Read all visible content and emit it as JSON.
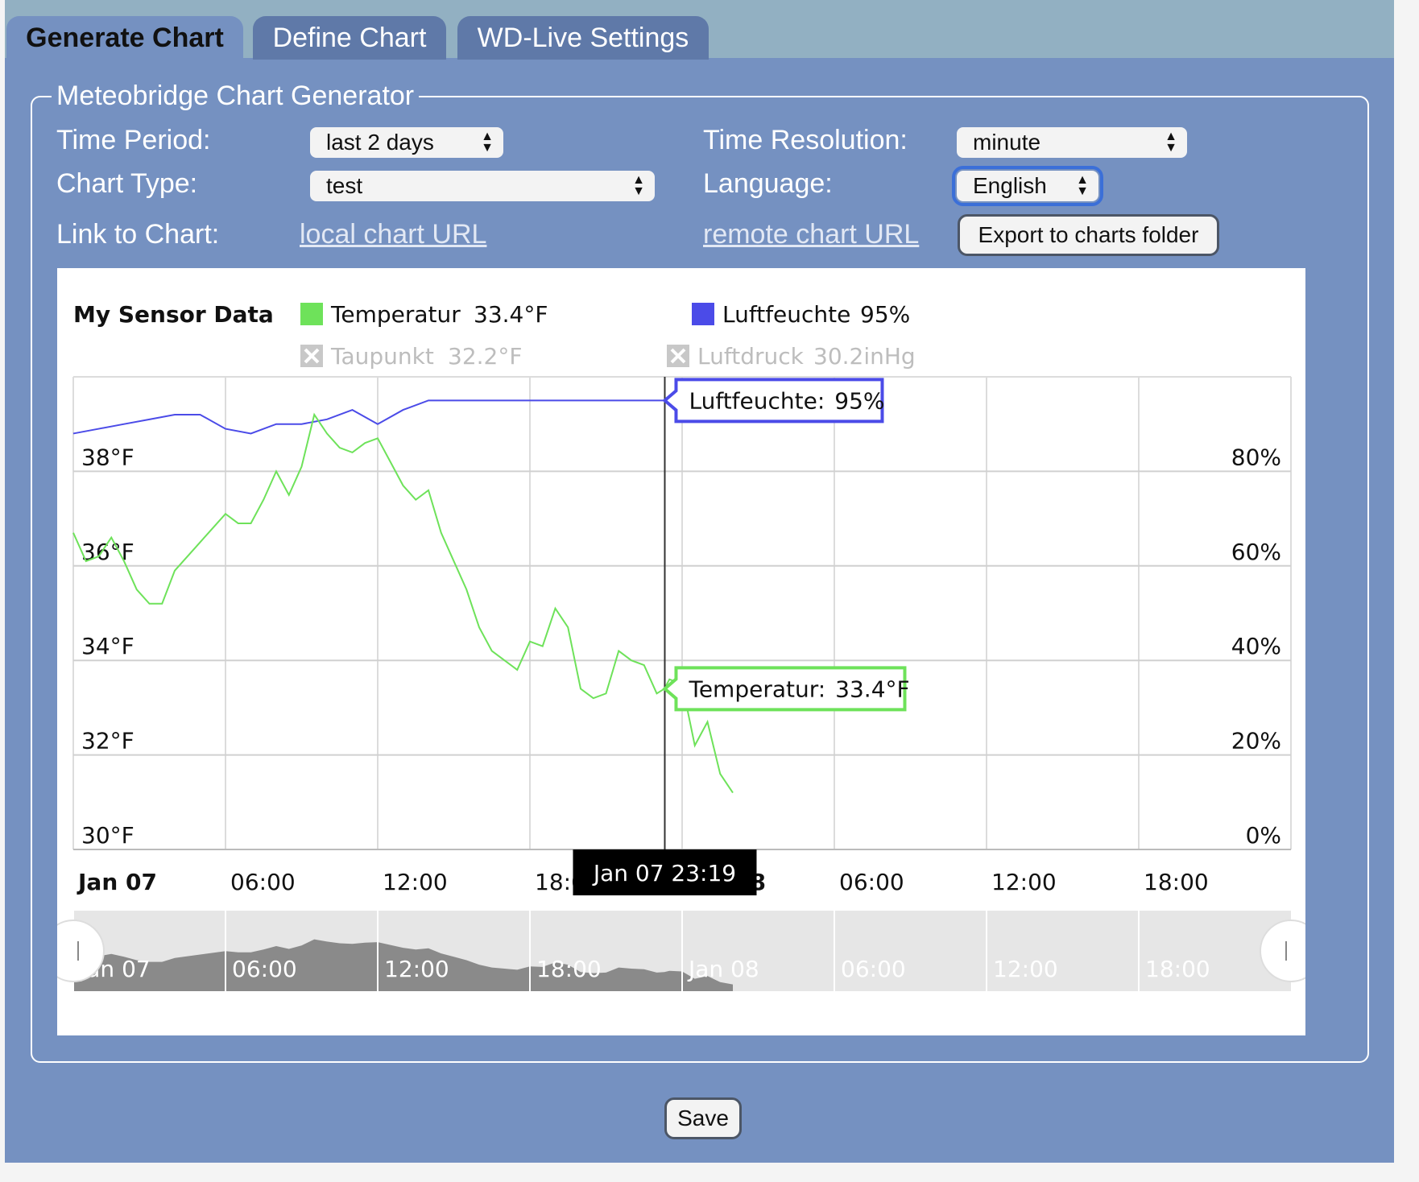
{
  "tabs": [
    {
      "label": "Generate Chart",
      "active": true
    },
    {
      "label": "Define Chart",
      "active": false
    },
    {
      "label": "WD-Live Settings",
      "active": false
    }
  ],
  "generator": {
    "legend": "Meteobridge Chart Generator",
    "time_period_label": "Time Period:",
    "time_period_value": "last 2 days",
    "time_resolution_label": "Time Resolution:",
    "time_resolution_value": "minute",
    "chart_type_label": "Chart Type:",
    "chart_type_value": "test",
    "language_label": "Language:",
    "language_value": "English",
    "link_label": "Link to Chart:",
    "local_link": "local chart URL",
    "remote_link": "remote chart URL",
    "export_button": "Export to charts folder"
  },
  "save_button": "Save",
  "colors": {
    "temperature": "#6ee25a",
    "humidity": "#4b4be8",
    "navigator": "#8a8a8a",
    "panel": "#7591c1"
  },
  "chart_data": {
    "type": "line",
    "title": "My Sensor Data",
    "legend": [
      {
        "name": "Temperatur",
        "value": "33.4°F",
        "enabled": true
      },
      {
        "name": "Luftfeuchte",
        "value": "95%",
        "enabled": true
      },
      {
        "name": "Taupunkt",
        "value": "32.2°F",
        "enabled": false
      },
      {
        "name": "Luftdruck",
        "value": "30.2inHg",
        "enabled": false
      }
    ],
    "x_ticks": [
      "Jan 07",
      "06:00",
      "12:00",
      "18:00",
      "Jan 08",
      "06:00",
      "12:00",
      "18:00"
    ],
    "xlim": [
      "Jan 07 00:00",
      "Jan 08 24:00"
    ],
    "y_left_ticks": [
      "30°F",
      "32°F",
      "34°F",
      "36°F",
      "38°F"
    ],
    "y_left_range": [
      30,
      40
    ],
    "y_right_ticks": [
      "0%",
      "20%",
      "40%",
      "60%",
      "80%"
    ],
    "y_right_range": [
      0,
      100
    ],
    "series": [
      {
        "name": "Temperatur",
        "axis": "left",
        "x_hours": [
          0,
          0.5,
          1,
          1.5,
          2,
          2.5,
          3,
          3.5,
          4,
          5,
          5.5,
          6,
          6.5,
          7,
          7.5,
          8,
          8.5,
          9,
          9.5,
          10,
          10.5,
          11,
          11.5,
          12,
          12.5,
          13,
          13.5,
          14,
          14.5,
          15,
          15.5,
          16,
          16.5,
          17,
          17.5,
          18,
          18.5,
          19,
          19.5,
          20,
          20.5,
          21,
          21.5,
          22,
          22.5,
          23,
          23.3,
          23.5,
          24,
          24.5,
          25,
          25.5,
          26
        ],
        "values": [
          36.7,
          36.1,
          36.2,
          36.6,
          36.1,
          35.5,
          35.2,
          35.2,
          35.9,
          36.5,
          36.8,
          37.1,
          36.9,
          36.9,
          37.4,
          38,
          37.5,
          38.1,
          39.2,
          38.8,
          38.5,
          38.4,
          38.6,
          38.7,
          38.2,
          37.7,
          37.4,
          37.6,
          36.7,
          36.1,
          35.5,
          34.7,
          34.2,
          34,
          33.8,
          34.4,
          34.3,
          35.1,
          34.7,
          33.4,
          33.2,
          33.3,
          34.2,
          34,
          33.9,
          33.3,
          33.4,
          33.6,
          33.5,
          32.2,
          32.7,
          31.6,
          31.2
        ]
      },
      {
        "name": "Luftfeuchte",
        "axis": "right",
        "x_hours": [
          0,
          1,
          2,
          3,
          4,
          5,
          6,
          7,
          8,
          9,
          10,
          11,
          12,
          13,
          14,
          15,
          16,
          17,
          18,
          19,
          20,
          21,
          22,
          23,
          23.3
        ],
        "values": [
          88,
          89,
          90,
          91,
          92,
          92,
          89,
          88,
          90,
          90,
          91,
          93,
          90,
          93,
          95,
          95,
          95,
          95,
          95,
          95,
          95,
          95,
          95,
          95,
          95
        ]
      }
    ],
    "crosshair": {
      "x_label": "Jan 07 23:19"
    },
    "tooltips": [
      {
        "label": "Luftfeuchte:",
        "value": "95%"
      },
      {
        "label": "Temperatur:",
        "value": "33.4°F"
      }
    ],
    "navigator_ticks": [
      "Jan 07",
      "06:00",
      "12:00",
      "18:00",
      "Jan 08",
      "06:00",
      "12:00",
      "18:00"
    ]
  }
}
